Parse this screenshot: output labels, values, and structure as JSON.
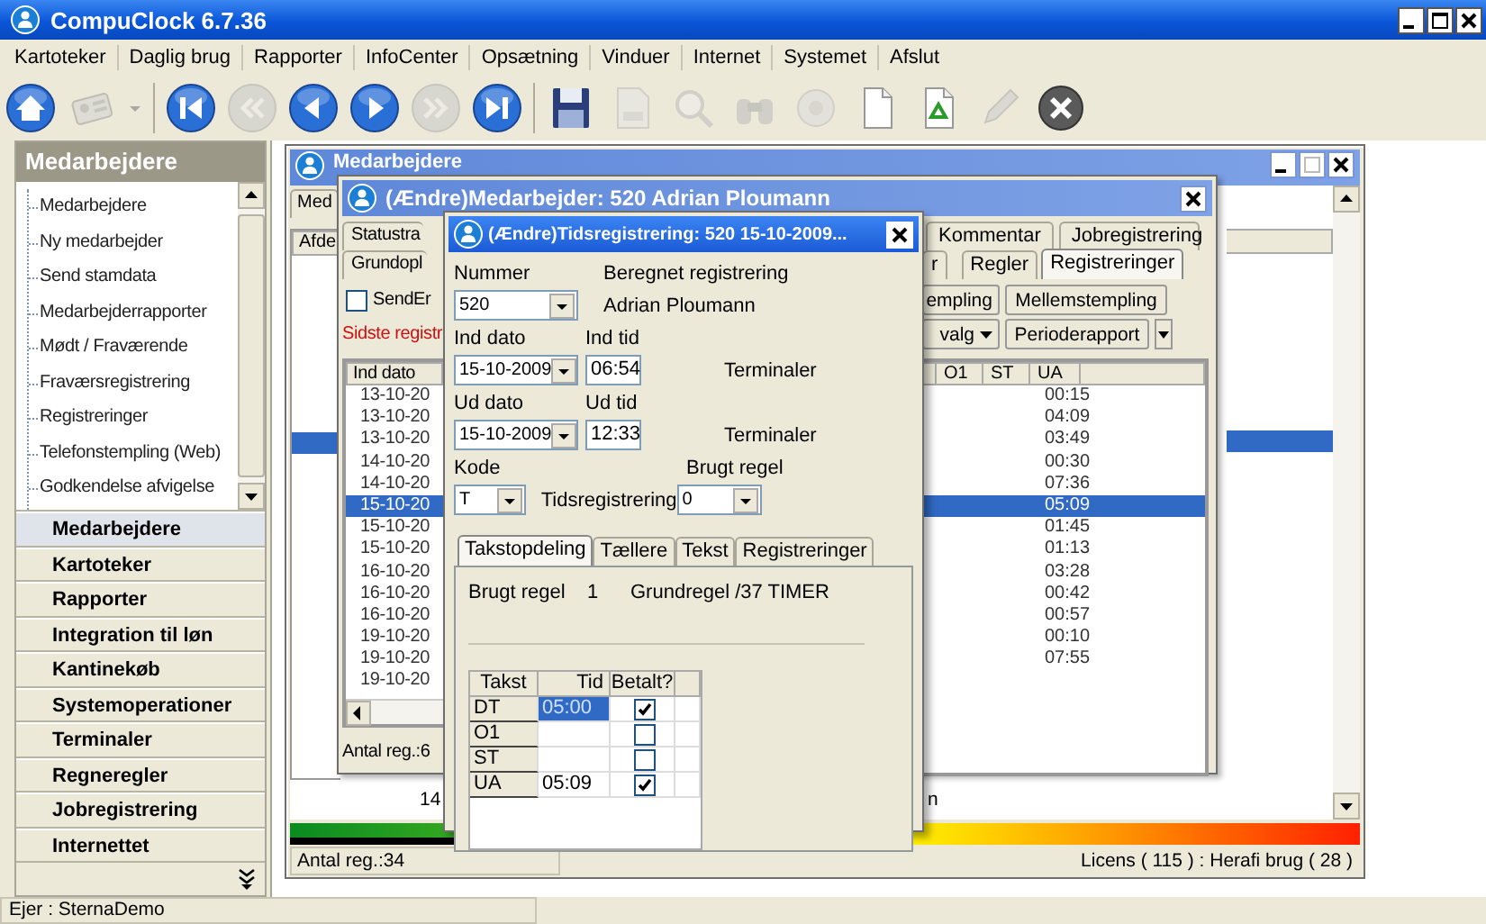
{
  "window": {
    "title": "CompuClock 6.7.36"
  },
  "menu": [
    "Kartoteker",
    "Daglig brug",
    "Rapporter",
    "InfoCenter",
    "Opsætning",
    "Vinduer",
    "Internet",
    "Systemet",
    "Afslut"
  ],
  "toolbar": [
    {
      "kind": "home",
      "disabled": false
    },
    {
      "kind": "card",
      "disabled": true
    },
    {
      "kind": "dropdown",
      "disabled": true
    },
    {
      "kind": "separator"
    },
    {
      "kind": "first",
      "disabled": false
    },
    {
      "kind": "rewind",
      "disabled": true
    },
    {
      "kind": "prev",
      "disabled": false
    },
    {
      "kind": "next",
      "disabled": false
    },
    {
      "kind": "forward",
      "disabled": true
    },
    {
      "kind": "last",
      "disabled": false
    },
    {
      "kind": "separator"
    },
    {
      "kind": "save",
      "disabled": false
    },
    {
      "kind": "print",
      "disabled": true
    },
    {
      "kind": "preview",
      "disabled": true
    },
    {
      "kind": "binoculars",
      "disabled": true
    },
    {
      "kind": "disc",
      "disabled": true
    },
    {
      "kind": "document",
      "disabled": false
    },
    {
      "kind": "recycle",
      "disabled": false
    },
    {
      "kind": "pencil",
      "disabled": true
    },
    {
      "kind": "close",
      "disabled": false
    }
  ],
  "sidebar": {
    "title": "Medarbejdere",
    "tree": [
      "Medarbejdere",
      "Ny medarbejder",
      "Send stamdata",
      "Medarbejderrapporter",
      "Mødt / Fraværende",
      "Fraværsregistrering",
      "Registreringer",
      "Telefonstempling (Web)",
      "Godkendelse afvigelse"
    ],
    "sections": [
      {
        "label": "Medarbejdere",
        "selected": true
      },
      {
        "label": "Kartoteker",
        "selected": false
      },
      {
        "label": "Rapporter",
        "selected": false
      },
      {
        "label": "Integration til løn",
        "selected": false
      },
      {
        "label": "Kantinekøb",
        "selected": false
      },
      {
        "label": "Systemoperationer",
        "selected": false
      },
      {
        "label": "Terminaler",
        "selected": false
      },
      {
        "label": "Regneregler",
        "selected": false
      },
      {
        "label": "Jobregistrering",
        "selected": false
      },
      {
        "label": "Internettet",
        "selected": false
      }
    ]
  },
  "employees_window": {
    "title": "Medarbejdere",
    "tab": "Med",
    "column": "Afde",
    "rows": [
      {
        "selected": false
      },
      {
        "selected": false
      },
      {
        "selected": false
      },
      {
        "selected": false
      },
      {
        "selected": false
      },
      {
        "selected": false
      },
      {
        "selected": false
      },
      {
        "selected": false
      },
      {
        "selected": true
      }
    ],
    "summary": [
      "14",
      "n"
    ],
    "license_usage": {
      "level": 0.24
    },
    "count": "Antal reg.:34",
    "license": "Licens ( 115 ) : Herafi brug ( 28 )"
  },
  "employee_window": {
    "title": "(Ændre)Medarbejder: 520  Adrian Ploumann",
    "tabs_row_1": [
      {
        "label": "Statustra",
        "selected": false
      },
      {
        "label": "Kommentar",
        "selected": false
      },
      {
        "label": "Jobregistrering",
        "selected": false
      }
    ],
    "tabs_row_2": [
      {
        "label": "Grundopl",
        "selected": false
      },
      {
        "label": "r",
        "selected": false
      },
      {
        "label": "Regler",
        "selected": false
      },
      {
        "label": "Registreringer",
        "selected": true
      }
    ],
    "send_checkbox": {
      "label": "SendEr",
      "checked": false
    },
    "last_registration": "Sidste registr",
    "buttons": [
      {
        "label": "empling",
        "kind": "plain"
      },
      {
        "label": "Mellemstempling",
        "kind": "plain"
      },
      {
        "label": "valg",
        "kind": "menu"
      },
      {
        "label": "Perioderapport",
        "kind": "split"
      }
    ],
    "columns": {
      "left": "Ind dato",
      "right": [
        "O1",
        "ST",
        "UA"
      ]
    },
    "rows": [
      {
        "ind_dato": "13-10-20",
        "ua": "00:15",
        "selected": false
      },
      {
        "ind_dato": "13-10-20",
        "ua": "04:09",
        "selected": false
      },
      {
        "ind_dato": "13-10-20",
        "ua": "03:49",
        "selected": false
      },
      {
        "ind_dato": "14-10-20",
        "ua": "00:30",
        "selected": false
      },
      {
        "ind_dato": "14-10-20",
        "ua": "07:36",
        "selected": false
      },
      {
        "ind_dato": "15-10-20",
        "ua": "05:09",
        "selected": true
      },
      {
        "ind_dato": "15-10-20",
        "ua": "01:45",
        "selected": false
      },
      {
        "ind_dato": "15-10-20",
        "ua": "01:13",
        "selected": false
      },
      {
        "ind_dato": "16-10-20",
        "ua": "03:28",
        "selected": false
      },
      {
        "ind_dato": "16-10-20",
        "ua": "00:42",
        "selected": false
      },
      {
        "ind_dato": "16-10-20",
        "ua": "00:57",
        "selected": false
      },
      {
        "ind_dato": "19-10-20",
        "ua": "00:10",
        "selected": false
      },
      {
        "ind_dato": "19-10-20",
        "ua": "07:55",
        "selected": false
      },
      {
        "ind_dato": "19-10-20",
        "selected": false
      }
    ],
    "count": "Antal reg.:6"
  },
  "time_dialog": {
    "title": "(Ændre)Tidsregistrering: 520  15-10-2009...",
    "nummer": {
      "label": "Nummer",
      "value": "520"
    },
    "computed_label": "Beregnet registrering",
    "employee_name": "Adrian Ploumann",
    "ind_dato": {
      "label": "Ind dato",
      "value": "15-10-2009"
    },
    "ind_tid": {
      "label": "Ind tid",
      "value": "06:54"
    },
    "ind_source": "Terminaler",
    "ud_dato": {
      "label": "Ud dato",
      "value": "15-10-2009"
    },
    "ud_tid": {
      "label": "Ud tid",
      "value": "12:33"
    },
    "ud_source": "Terminaler",
    "kode": {
      "label": "Kode",
      "value": "T"
    },
    "kode_text": "Tidsregistrering",
    "brugt_regel": {
      "label": "Brugt regel",
      "value": "0"
    },
    "tabs": [
      {
        "label": "Takstopdeling",
        "selected": true
      },
      {
        "label": "Tællere",
        "selected": false
      },
      {
        "label": "Tekst",
        "selected": false
      },
      {
        "label": "Registreringer",
        "selected": false
      }
    ],
    "rule": {
      "label": "Brugt regel",
      "number": "1",
      "name": "Grundregel /37 TIMER"
    },
    "grid": {
      "columns": [
        "Takst",
        "Tid",
        "Betalt?"
      ],
      "rows": [
        {
          "takst": "DT",
          "tid": "05:00",
          "paid": true,
          "selected": true
        },
        {
          "takst": "O1",
          "paid": false,
          "selected": false
        },
        {
          "takst": "ST",
          "paid": false,
          "selected": false
        },
        {
          "takst": "UA",
          "tid": "05:09",
          "paid": true,
          "selected": false
        }
      ]
    }
  },
  "status_bar": {
    "owner": "Ejer : SternaDemo"
  }
}
